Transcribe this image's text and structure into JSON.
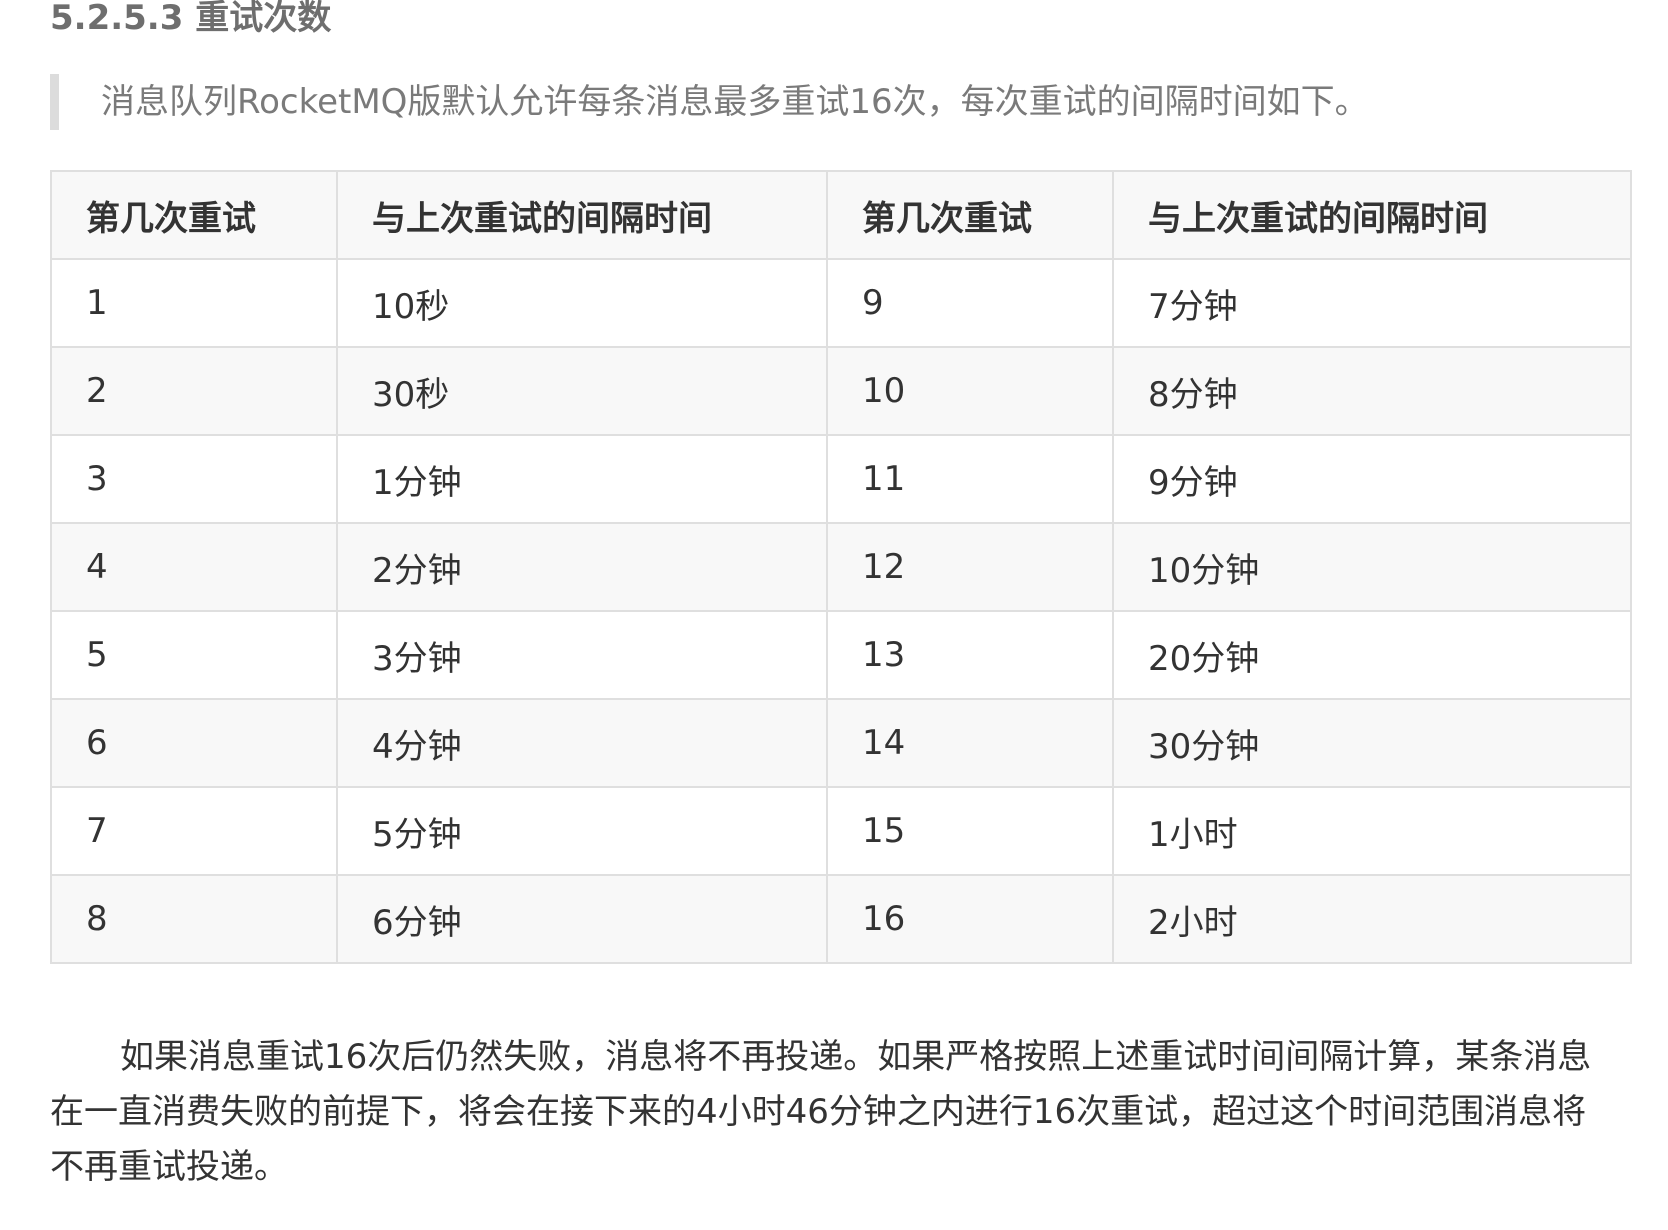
{
  "heading": "5.2.5.3 重试次数",
  "quote": "消息队列RocketMQ版默认允许每条消息最多重试16次，每次重试的间隔时间如下。",
  "table": {
    "headers": [
      "第几次重试",
      "与上次重试的间隔时间",
      "第几次重试",
      "与上次重试的间隔时间"
    ],
    "rows": [
      [
        "1",
        "10秒",
        "9",
        "7分钟"
      ],
      [
        "2",
        "30秒",
        "10",
        "8分钟"
      ],
      [
        "3",
        "1分钟",
        "11",
        "9分钟"
      ],
      [
        "4",
        "2分钟",
        "12",
        "10分钟"
      ],
      [
        "5",
        "3分钟",
        "13",
        "20分钟"
      ],
      [
        "6",
        "4分钟",
        "14",
        "30分钟"
      ],
      [
        "7",
        "5分钟",
        "15",
        "1小时"
      ],
      [
        "8",
        "6分钟",
        "16",
        "2小时"
      ]
    ]
  },
  "paragraph": "如果消息重试16次后仍然失败，消息将不再投递。如果严格按照上述重试时间间隔计算，某条消息在一直消费失败的前提下，将会在接下来的4小时46分钟之内进行16次重试，超过这个时间范围消息将不再重试投递。"
}
